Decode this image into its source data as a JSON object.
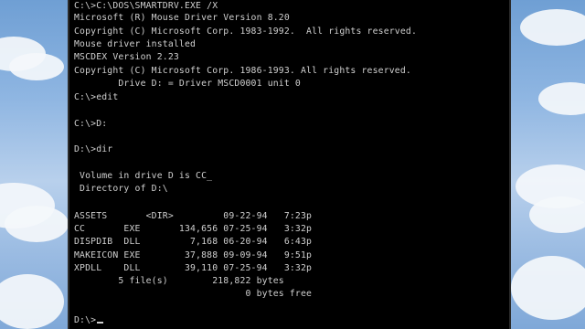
{
  "terminal": {
    "lines": [
      {
        "text": "C:\\>C:\\DOS\\SMARTDRV.EXE /X"
      },
      {
        "text": "Microsoft (R) Mouse Driver Version 8.20"
      },
      {
        "text": "Copyright (C) Microsoft Corp. 1983-1992.  All rights reserved."
      },
      {
        "text": "Mouse driver installed"
      },
      {
        "text": "MSCDEX Version 2.23"
      },
      {
        "text": "Copyright (C) Microsoft Corp. 1986-1993. All rights reserved."
      },
      {
        "text": "        Drive D: = Driver MSCD0001 unit 0"
      },
      {
        "text": "C:\\>edit"
      },
      {
        "text": "C:\\>D:"
      },
      {
        "text": "D:\\>dir"
      },
      {
        "text": " Volume in drive D is CC_"
      },
      {
        "text": " Directory of D:\\"
      },
      {
        "text": "ASSETS       <DIR>         09-22-94   7:23p"
      },
      {
        "text": "CC       EXE       134,656 07-25-94   3:32p"
      },
      {
        "text": "DISPDIB  DLL         7,168 06-20-94   6:43p"
      },
      {
        "text": "MAKEICON EXE        37,888 09-09-94   9:51p"
      },
      {
        "text": "XPDLL    DLL        39,110 07-25-94   3:32p"
      },
      {
        "text": "        5 file(s)        218,822 bytes"
      },
      {
        "text": "                               0 bytes free"
      }
    ],
    "prompt": "D:\\>"
  },
  "colors": {
    "terminal_bg": "#000000",
    "terminal_text": "#cfcfcf",
    "desktop_sky": "#8fb6e2"
  }
}
